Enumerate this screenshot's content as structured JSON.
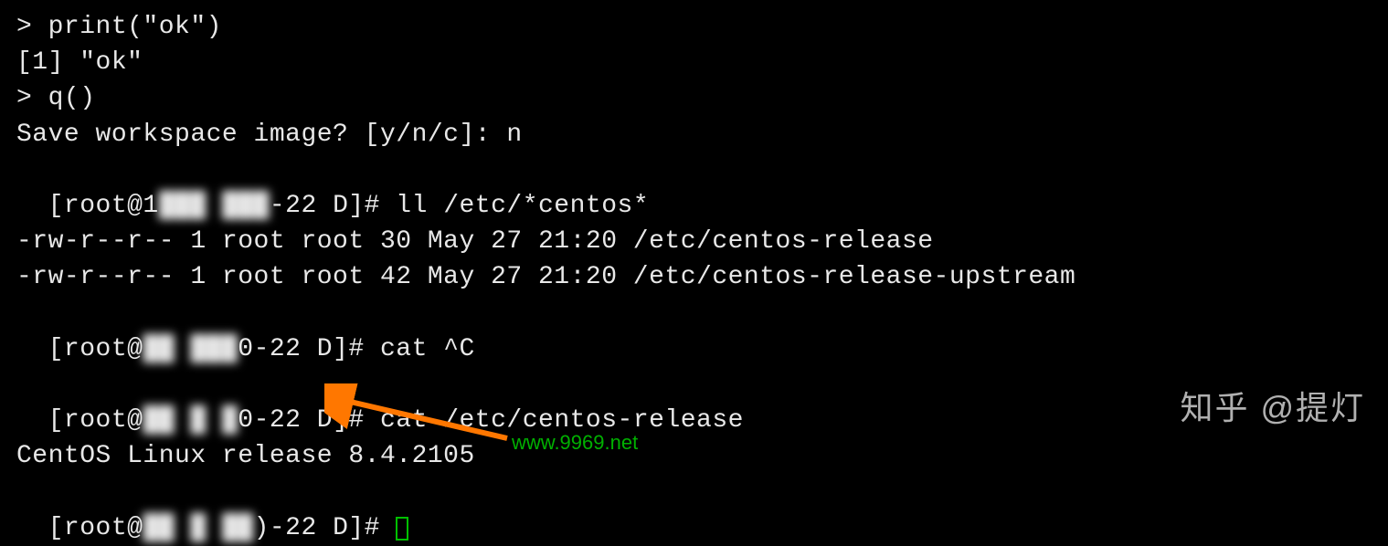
{
  "lines": {
    "l1": "> print(\"ok\")",
    "l2": "[1] \"ok\"",
    "l3": "> q()",
    "l4": "Save workspace image? [y/n/c]: n",
    "l5_pre": "[root@1",
    "l5_blur": "███ ███",
    "l5_post": "-22 D]# ll /etc/*centos*",
    "l6": "-rw-r--r-- 1 root root 30 May 27 21:20 /etc/centos-release",
    "l7": "-rw-r--r-- 1 root root 42 May 27 21:20 /etc/centos-release-upstream",
    "l8_pre": "[root@",
    "l8_blur": "██ ███",
    "l8_post": "0-22 D]# cat ^C",
    "l9_pre": "[root@",
    "l9_blur": "██ █ █",
    "l9_post": "0-22 D]# cat /etc/centos-release",
    "l10": "CentOS Linux release 8.4.2105",
    "l11_pre": "[root@",
    "l11_blur": "██ █ ██",
    "l11_post": ")-22 D]# "
  },
  "watermarks": {
    "url": "www.9969.net",
    "zhihu": "知乎 @提灯"
  }
}
